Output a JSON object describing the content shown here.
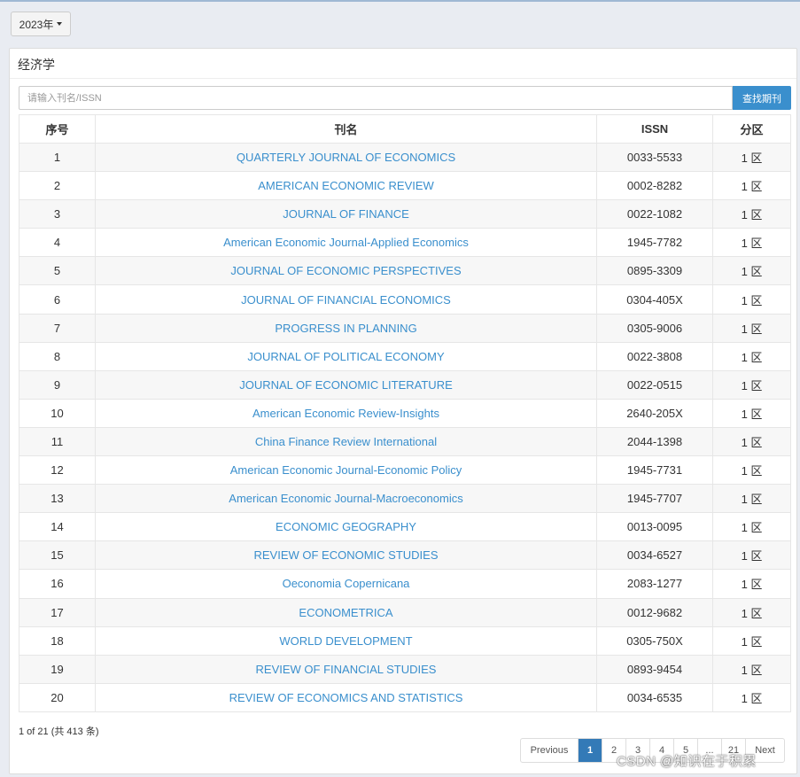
{
  "year_filter": {
    "label": "2023年"
  },
  "panel": {
    "title": "经济学"
  },
  "search": {
    "placeholder": "请输入刊名/ISSN",
    "value": "",
    "button_label": "查找期刊"
  },
  "table": {
    "headers": [
      "序号",
      "刊名",
      "ISSN",
      "分区"
    ],
    "rows": [
      {
        "no": "1",
        "name": "QUARTERLY JOURNAL OF ECONOMICS",
        "issn": "0033-5533",
        "zone": "1 区"
      },
      {
        "no": "2",
        "name": "AMERICAN ECONOMIC REVIEW",
        "issn": "0002-8282",
        "zone": "1 区"
      },
      {
        "no": "3",
        "name": "JOURNAL OF FINANCE",
        "issn": "0022-1082",
        "zone": "1 区"
      },
      {
        "no": "4",
        "name": "American Economic Journal-Applied Economics",
        "issn": "1945-7782",
        "zone": "1 区"
      },
      {
        "no": "5",
        "name": "JOURNAL OF ECONOMIC PERSPECTIVES",
        "issn": "0895-3309",
        "zone": "1 区"
      },
      {
        "no": "6",
        "name": "JOURNAL OF FINANCIAL ECONOMICS",
        "issn": "0304-405X",
        "zone": "1 区"
      },
      {
        "no": "7",
        "name": "PROGRESS IN PLANNING",
        "issn": "0305-9006",
        "zone": "1 区"
      },
      {
        "no": "8",
        "name": "JOURNAL OF POLITICAL ECONOMY",
        "issn": "0022-3808",
        "zone": "1 区"
      },
      {
        "no": "9",
        "name": "JOURNAL OF ECONOMIC LITERATURE",
        "issn": "0022-0515",
        "zone": "1 区"
      },
      {
        "no": "10",
        "name": "American Economic Review-Insights",
        "issn": "2640-205X",
        "zone": "1 区"
      },
      {
        "no": "11",
        "name": "China Finance Review International",
        "issn": "2044-1398",
        "zone": "1 区"
      },
      {
        "no": "12",
        "name": "American Economic Journal-Economic Policy",
        "issn": "1945-7731",
        "zone": "1 区"
      },
      {
        "no": "13",
        "name": "American Economic Journal-Macroeconomics",
        "issn": "1945-7707",
        "zone": "1 区"
      },
      {
        "no": "14",
        "name": "ECONOMIC GEOGRAPHY",
        "issn": "0013-0095",
        "zone": "1 区"
      },
      {
        "no": "15",
        "name": "REVIEW OF ECONOMIC STUDIES",
        "issn": "0034-6527",
        "zone": "1 区"
      },
      {
        "no": "16",
        "name": "Oeconomia Copernicana",
        "issn": "2083-1277",
        "zone": "1 区"
      },
      {
        "no": "17",
        "name": "ECONOMETRICA",
        "issn": "0012-9682",
        "zone": "1 区"
      },
      {
        "no": "18",
        "name": "WORLD DEVELOPMENT",
        "issn": "0305-750X",
        "zone": "1 区"
      },
      {
        "no": "19",
        "name": "REVIEW OF FINANCIAL STUDIES",
        "issn": "0893-9454",
        "zone": "1 区"
      },
      {
        "no": "20",
        "name": "REVIEW OF ECONOMICS AND STATISTICS",
        "issn": "0034-6535",
        "zone": "1 区"
      }
    ]
  },
  "summary": "1 of 21 (共 413 条)",
  "pagination": {
    "previous": "Previous",
    "pages": [
      "1",
      "2",
      "3",
      "4",
      "5",
      "...",
      "21"
    ],
    "active": "1",
    "next": "Next"
  },
  "watermark": "CSDN @知识在于积累",
  "colors": {
    "link": "#3a8fcd",
    "primary_button": "#3a8fcd",
    "active_page": "#337ab7"
  }
}
